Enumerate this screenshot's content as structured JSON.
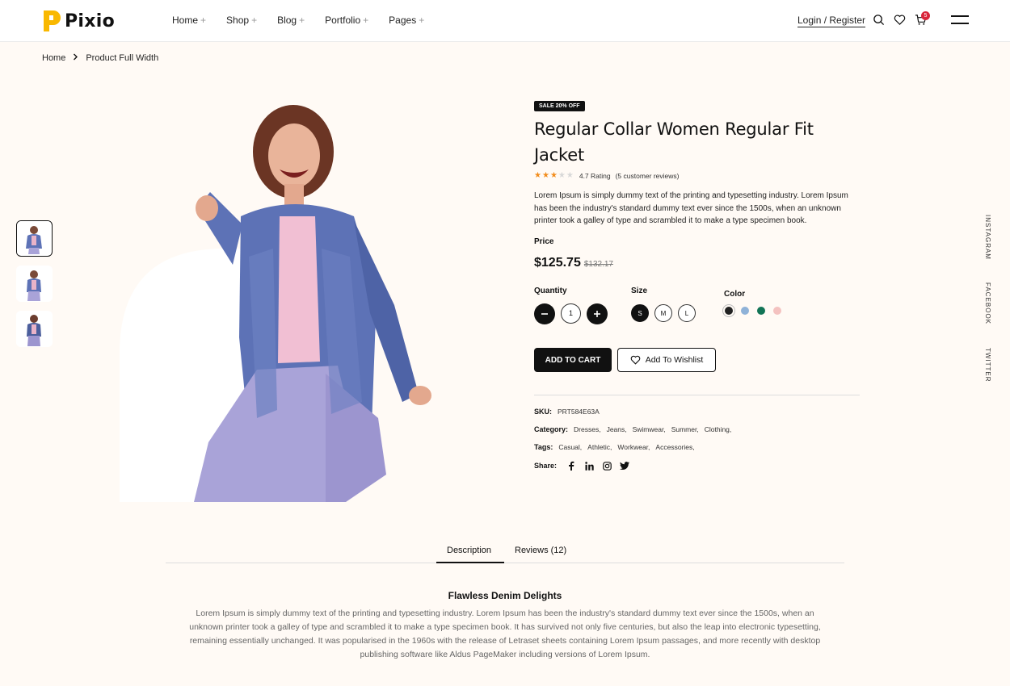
{
  "header": {
    "logo_text": "Pixio",
    "nav": [
      {
        "label": "Home"
      },
      {
        "label": "Shop"
      },
      {
        "label": "Blog"
      },
      {
        "label": "Portfolio"
      },
      {
        "label": "Pages"
      }
    ],
    "login_label": "Login / Register",
    "cart_count": "5",
    "icons": [
      "search-icon",
      "heart-icon",
      "cart-icon",
      "menu-icon"
    ]
  },
  "breadcrumb": {
    "home": "Home",
    "current": "Product Full Width"
  },
  "product": {
    "badge": "SALE 20% OFF",
    "title": "Regular Collar Women Regular Fit Jacket",
    "rating_stars": 3,
    "rating_max": 5,
    "rating_text": "4.7 Rating",
    "reviews_text": "(5 customer reviews)",
    "description": "Lorem Ipsum is simply dummy text of the printing and typesetting industry. Lorem Ipsum has been the industry's standard dummy text ever since the 1500s, when an unknown printer took a galley of type and scrambled it to make a type specimen book.",
    "price_label": "Price",
    "price": "$125.75",
    "old_price": "$132.17",
    "quantity_label": "Quantity",
    "quantity": "1",
    "size_label": "Size",
    "sizes": [
      "S",
      "M",
      "L"
    ],
    "selected_size": "S",
    "color_label": "Color",
    "colors": [
      "#222222",
      "#8fb2d8",
      "#127456",
      "#f4c2c0"
    ],
    "add_to_cart": "ADD TO CART",
    "wishlist": "Add To Wishlist",
    "sku_label": "SKU:",
    "sku": "PRT584E63A",
    "category_label": "Category:",
    "categories": [
      "Dresses,",
      "Jeans,",
      "Swimwear,",
      "Summer,",
      "Clothing,"
    ],
    "tags_label": "Tags:",
    "tags": [
      "Casual,",
      "Athletic,",
      "Workwear,",
      "Accessories,"
    ],
    "share_label": "Share:",
    "share_icons": [
      "facebook-icon",
      "linkedin-icon",
      "instagram-icon",
      "twitter-icon"
    ]
  },
  "social": [
    "INSTAGRAM",
    "FACEBOOK",
    "TWITTER"
  ],
  "tabs": {
    "description": "Description",
    "reviews": "Reviews (12)",
    "active": "Description"
  },
  "content": {
    "title": "Flawless Denim Delights",
    "text": "Lorem Ipsum is simply dummy text of the printing and typesetting industry. Lorem Ipsum has been the industry's standard dummy text ever since the 1500s, when an unknown printer took a galley of type and scrambled it to make a type specimen book. It has survived not only five centuries, but also the leap into electronic typesetting, remaining essentially unchanged. It was popularised in the 1960s with the release of Letraset sheets containing Lorem Ipsum passages, and more recently with desktop publishing software like Aldus PageMaker including versions of Lorem Ipsum."
  },
  "colors": {
    "accent_yellow": "#f9b800",
    "star_orange": "#f28c1b",
    "badge_red": "#d9263b",
    "background": "#fffaf5"
  }
}
